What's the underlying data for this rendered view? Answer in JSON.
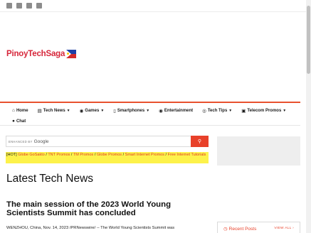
{
  "social": [
    "facebook-icon",
    "twitter-icon",
    "instagram-icon",
    "youtube-icon"
  ],
  "logo": {
    "text": "PinoyTechSaga"
  },
  "nav": {
    "home": "Home",
    "tech_news": "Tech News",
    "games": "Games",
    "smartphones": "Smartphones",
    "entertainment": "Entertainment",
    "tech_tips": "Tech Tips",
    "telecom_promos": "Telecom Promos",
    "chat": "Chat"
  },
  "search": {
    "brand_prefix": "ENHANCED BY",
    "brand": "Google",
    "value": ""
  },
  "promo": {
    "tag": "[HOT]",
    "links": [
      "Globe GoSakto",
      "TNT Promos",
      "TM Promos",
      "Globe Promos",
      "Smart Internet Promos",
      "Free Internet Tutorials"
    ],
    "separators": [
      " / ",
      " / ",
      " / ",
      " / ",
      " / "
    ]
  },
  "section_title": "Latest Tech News",
  "article": {
    "title": "The main session of the 2023 World Young Scientists Summit has concluded",
    "excerpt": "WENZHOU, China, Nov. 14, 2023 /PRNewswire/ -- The World Young Scientists Summit was"
  },
  "sidebar": {
    "recent_title": "Recent Posts",
    "view_all": "VIEW ALL"
  },
  "colors": {
    "accent": "#e8412a",
    "promo_bg": "#fdf24b",
    "logo": "#d6263a"
  }
}
